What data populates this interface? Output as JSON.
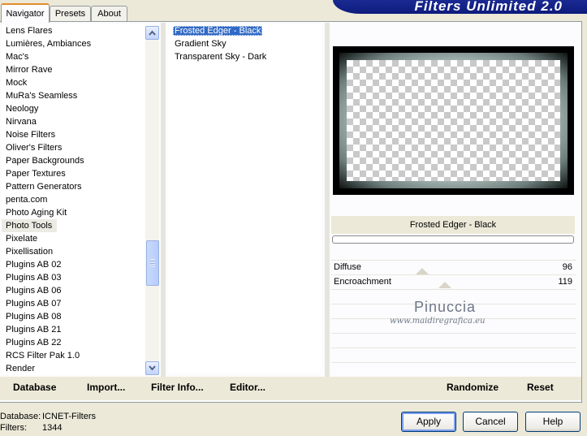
{
  "tabs": [
    {
      "label": "Navigator"
    },
    {
      "label": "Presets"
    },
    {
      "label": "About"
    }
  ],
  "banner": "Filters Unlimited 2.0",
  "categories": [
    "Lens Flares",
    "Lumières, Ambiances",
    "Mac's",
    "Mirror Rave",
    "Mock",
    "MuRa's Seamless",
    "Neology",
    "Nirvana",
    "Noise Filters",
    "Oliver's Filters",
    "Paper Backgrounds",
    "Paper Textures",
    "Pattern Generators",
    "penta.com",
    "Photo Aging Kit",
    "Photo Tools",
    "Pixelate",
    "Pixellisation",
    "Plugins AB 02",
    "Plugins AB 03",
    "Plugins AB 06",
    "Plugins AB 07",
    "Plugins AB 08",
    "Plugins AB 21",
    "Plugins AB 22",
    "RCS Filter Pak 1.0",
    "Render"
  ],
  "selected_category": "Photo Tools",
  "filters": [
    "Frosted Edger - Black",
    "Gradient Sky",
    "Transparent Sky - Dark"
  ],
  "selected_filter": "Frosted Edger - Black",
  "preview_title": "Frosted Edger - Black",
  "params": [
    {
      "label": "Diffuse",
      "value": "96"
    },
    {
      "label": "Encroachment",
      "value": "119"
    }
  ],
  "watermark": {
    "line1": "Pinuccia",
    "line2": "www.maidiregrafica.eu"
  },
  "footer": {
    "database": "Database",
    "import": "Import...",
    "filter_info": "Filter Info...",
    "editor": "Editor...",
    "randomize": "Randomize",
    "reset": "Reset"
  },
  "info": {
    "database_label": "Database:",
    "database_value": "ICNET-Filters",
    "filters_label": "Filters:",
    "filters_value": "1344"
  },
  "buttons": {
    "apply": "Apply",
    "cancel": "Cancel",
    "help": "Help"
  }
}
